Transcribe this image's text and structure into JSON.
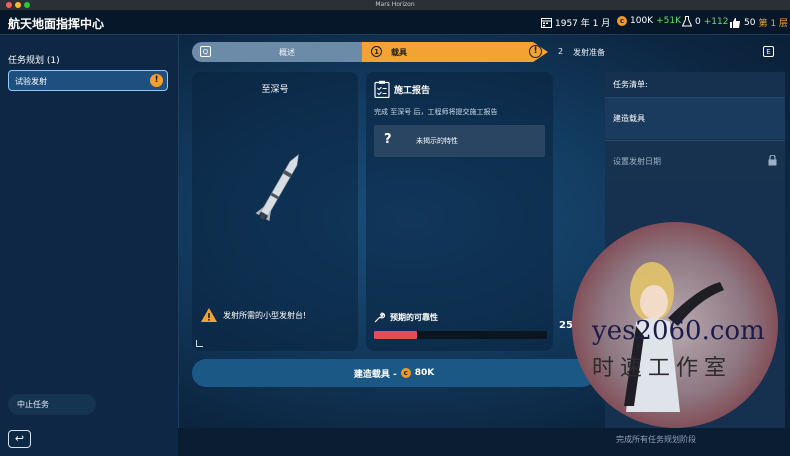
{
  "window": {
    "title": "Mars Horizon"
  },
  "header": {
    "title": "航天地面指挥中心",
    "date": "1957 年 1 月",
    "money": "100K",
    "money_delta": "+51K",
    "research": "0",
    "research_delta": "+112",
    "reputation": "50",
    "reputation_level": "第 1 层"
  },
  "sidebar": {
    "heading": "任务规划 (1)",
    "mission_item": "试验发射",
    "mission_badge": "!",
    "abort_label": "中止任务",
    "back_icon": "↩"
  },
  "tabs": {
    "overview": {
      "key": "Q",
      "label": "概述"
    },
    "vehicle": {
      "number": "1",
      "label": "载具",
      "badge": "!"
    },
    "launch": {
      "number": "2",
      "label": "发射准备",
      "key": "E"
    }
  },
  "vehicle_card": {
    "name": "至深号",
    "pad_warning": "发射所需的小型发射台!"
  },
  "report_card": {
    "title": "施工报告",
    "description": "完成 至深号 后，工程师将提交施工报告",
    "trait_icon": "?",
    "trait_label": "未揭示的特性",
    "reliability_label": "预期的可靠性",
    "reliability_value": "25%",
    "reliability_fraction": 0.25
  },
  "build_button": {
    "label": "建造载具 -",
    "cost": "80K"
  },
  "checklist": {
    "title": "任务清单:",
    "items": [
      {
        "label": "建造载具",
        "locked": false
      },
      {
        "label": "设置发射日期",
        "locked": true
      }
    ]
  },
  "footer": {
    "text": "完成所有任务规划阶段"
  },
  "watermark": {
    "line1": "yes2060.com",
    "line2": "时速工作室"
  },
  "colors": {
    "accent": "#f3a333",
    "bar_red": "#e24e57",
    "panel": "#16314f",
    "button": "#1b5885"
  }
}
